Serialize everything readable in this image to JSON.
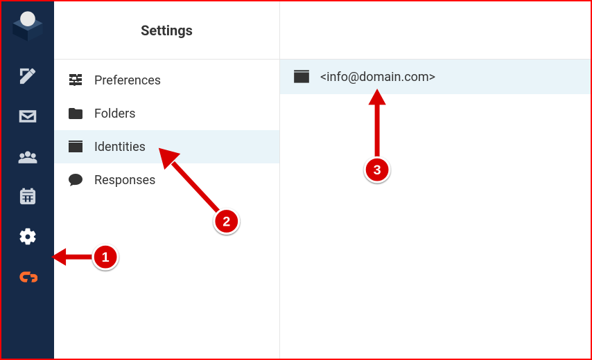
{
  "header": {
    "title": "Settings"
  },
  "rail": {
    "items": [
      {
        "name": "app-logo",
        "interactable": false
      },
      {
        "name": "compose",
        "interactable": true
      },
      {
        "name": "mail",
        "interactable": true
      },
      {
        "name": "contacts",
        "interactable": true
      },
      {
        "name": "calendar",
        "interactable": true
      },
      {
        "name": "settings",
        "interactable": true,
        "active": true
      },
      {
        "name": "cpanel",
        "interactable": true
      }
    ]
  },
  "settings": {
    "items": [
      {
        "label": "Preferences",
        "icon": "sliders-icon",
        "active": false
      },
      {
        "label": "Folders",
        "icon": "folder-icon",
        "active": false
      },
      {
        "label": "Identities",
        "icon": "identity-icon",
        "active": true
      },
      {
        "label": "Responses",
        "icon": "comment-icon",
        "active": false
      }
    ]
  },
  "identities": {
    "items": [
      {
        "label": "<info@domain.com>",
        "icon": "identity-icon"
      }
    ]
  },
  "annotations": [
    {
      "n": "1",
      "target": "settings-rail-icon"
    },
    {
      "n": "2",
      "target": "identities-menu-item"
    },
    {
      "n": "3",
      "target": "identity-entry"
    }
  ],
  "colors": {
    "selected_bg": "#e9f4f9",
    "rail_bg": "#162a48",
    "annotation": "#d90000"
  }
}
